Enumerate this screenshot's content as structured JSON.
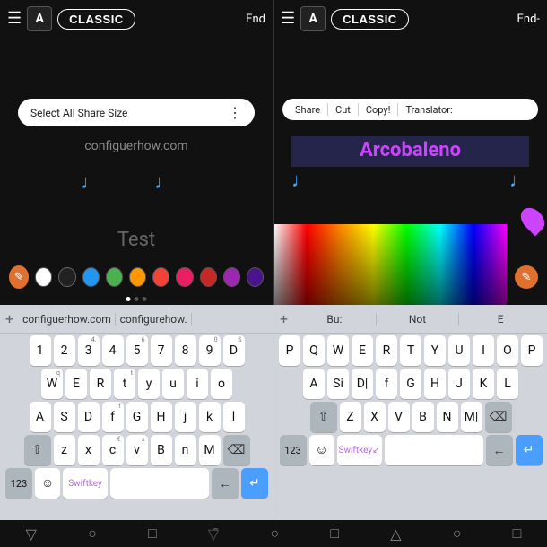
{
  "left_panel": {
    "top_bar": {
      "font_label": "A",
      "mode_label": "CLASSIC",
      "end_label": "End"
    },
    "context_menu": {
      "items": "Select All Share Size",
      "dots": "⋮"
    },
    "url_text": "configuerhow.com",
    "test_text": "Test",
    "colors": [
      "#fff",
      "#111",
      "#2196f3",
      "#4caf50",
      "#ff9800",
      "#ff5722",
      "#e91e63",
      "#9c27b0"
    ],
    "palette_eyedropper": "🖉"
  },
  "right_panel": {
    "top_bar": {
      "font_label": "A",
      "mode_label": "CLASSIC",
      "end_label": "End-"
    },
    "context_menu": {
      "items": [
        "Share",
        "Cut",
        "Copy!",
        "Translator:"
      ]
    },
    "arcobaleno_text": "Arcobaleno"
  },
  "left_keyboard": {
    "suggestion_bar": {
      "plus": "+",
      "words": [
        "configuerhow.com",
        "configurehow.",
        ""
      ]
    },
    "rows": [
      [
        "1",
        "2",
        "3",
        "4",
        "5",
        "6",
        "7",
        "8",
        "9",
        "0"
      ],
      [
        "q",
        "W",
        "E",
        "R",
        "t",
        "y",
        "u",
        "i",
        "o"
      ],
      [
        "A",
        "S",
        "D",
        "f",
        "G",
        "H",
        "j",
        "k",
        "l"
      ],
      [
        "shift",
        "z",
        "x",
        "c",
        "v",
        "B",
        "n",
        "M",
        "del"
      ],
      [
        "123",
        "emoji",
        "swiftkey",
        "space",
        "←",
        "↵"
      ]
    ]
  },
  "right_keyboard": {
    "suggestion_bar": {
      "plus": "+",
      "words": [
        "Bu:",
        "Not",
        "E"
      ]
    },
    "rows": [
      [
        "P",
        "Q",
        "W",
        "E",
        "R",
        "T",
        "Y",
        "U",
        "I",
        "O",
        "P"
      ],
      [
        "A",
        "Si",
        "D|",
        "f",
        "G",
        "H",
        "J",
        "K",
        "L"
      ],
      [
        "shift",
        "Z",
        "X",
        "V",
        "B",
        "N",
        "M|",
        "del"
      ],
      [
        "123",
        "emoji",
        "swiftkey",
        "space",
        "←",
        "↵"
      ]
    ]
  },
  "nav_bar": {
    "icons": [
      "▽",
      "○",
      "□",
      "▽",
      "○",
      "□",
      "△",
      "○",
      "□"
    ]
  },
  "colors": {
    "accent_purple": "#cc44ff",
    "accent_blue": "#4a9eff",
    "accent_orange": "#e07030"
  }
}
